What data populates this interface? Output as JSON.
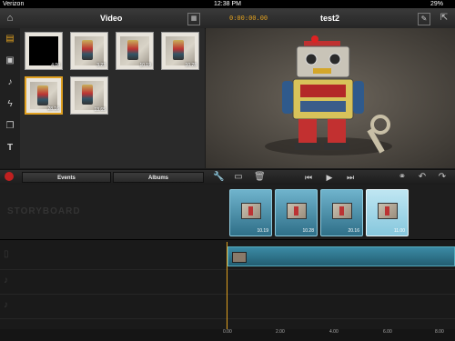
{
  "status": {
    "carrier": "Verizon",
    "time": "12:38 PM",
    "battery": "29%"
  },
  "toolbar": {
    "library_title": "Video",
    "timecode": "0:00:00.00",
    "project_title": "test2"
  },
  "library": {
    "thumbnails": [
      {
        "duration": "4.00",
        "selected": false,
        "black": true
      },
      {
        "duration": "3.23",
        "selected": false,
        "black": false
      },
      {
        "duration": "10.19",
        "selected": false,
        "black": false
      },
      {
        "duration": "10.28",
        "selected": false,
        "black": false
      },
      {
        "duration": "28.16",
        "selected": true,
        "black": false
      },
      {
        "duration": "13.65",
        "selected": false,
        "black": false
      }
    ]
  },
  "controls": {
    "events_label": "Events",
    "albums_label": "Albums"
  },
  "storyboard": {
    "label": "STORYBOARD",
    "clips": [
      {
        "duration": "10.19"
      },
      {
        "duration": "10.28"
      },
      {
        "duration": "20.16"
      },
      {
        "duration": "11.00"
      }
    ]
  },
  "ruler": {
    "ticks": [
      "0.00",
      "2.00",
      "4.00",
      "6.00",
      "8.00"
    ]
  },
  "colors": {
    "accent": "#e0a020",
    "clip": "#4a9ab8",
    "background": "#1b1b1b"
  },
  "icons": [
    "home-icon",
    "grid-icon",
    "edit-icon",
    "export-icon",
    "video-icon",
    "photo-icon",
    "music-icon",
    "effects-icon",
    "transitions-icon",
    "title-icon",
    "record-icon",
    "wrench-icon",
    "trash-icon",
    "rewind-icon",
    "play-icon",
    "forward-icon",
    "link-icon",
    "undo-icon",
    "redo-icon"
  ]
}
